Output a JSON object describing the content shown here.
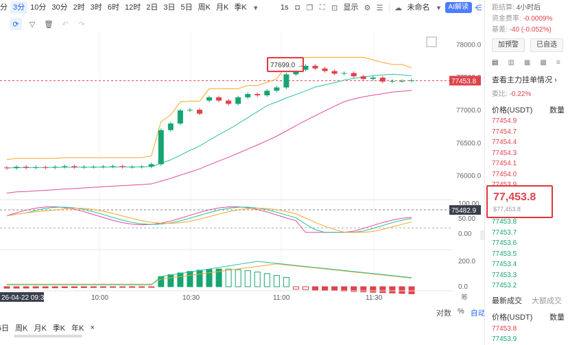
{
  "toolbar": {
    "timeframes": [
      "分",
      "3分",
      "10分",
      "30分",
      "2时",
      "3时",
      "6时",
      "12时",
      "2日",
      "3日",
      "5日",
      "周K",
      "月K",
      "季K"
    ],
    "active_timeframe": "3分",
    "speed": "1s",
    "display": "显示",
    "layout_name": "未命名",
    "ai_button": "AI解读"
  },
  "price_axis": {
    "labels": [
      "78000.0",
      "77500.0",
      "77000.0",
      "76500.0",
      "76000.0"
    ],
    "last_price": "77453.8",
    "low_marker": "75482.9",
    "annotation": "77699.0"
  },
  "indicator_axis": {
    "labels": [
      "100.00",
      "50.00",
      "0.00"
    ]
  },
  "volume_axis": {
    "labels": [
      "200.0",
      "0.0"
    ]
  },
  "time_axis": {
    "labels": [
      "10:00",
      "10:30",
      "11:00",
      "11:30"
    ],
    "cursor_time": "26-04-22 09:33"
  },
  "bottom_bar": {
    "periods": [
      "5日",
      "周K",
      "月K",
      "季K",
      "年K"
    ],
    "close": "×",
    "right": [
      "对数",
      "%",
      "自动"
    ]
  },
  "axis_side_label": "筹",
  "right_panel": {
    "settlement_label": "距结算:",
    "settlement_value": "4小时后",
    "funding_label": "资金费率:",
    "funding_value": "-0.0009%",
    "basis_label": "基差:",
    "basis_value": "-40 (-0.052%)",
    "alert_button": "加预警",
    "watchlist_button": "已自选",
    "depth_link": "查看主力挂单情况",
    "ratio_label": "委比:",
    "ratio_value": "-0.22%",
    "header_price": "价格(USDT)",
    "header_qty": "数量",
    "asks": [
      "77454.9",
      "77454.7",
      "77454.4",
      "77454.3",
      "77454.1",
      "77454.0",
      "77453.9"
    ],
    "last_price": "77,453.8",
    "last_price_usd": "$77,453.8",
    "bids": [
      "77453.8",
      "77453.7",
      "77453.6",
      "77453.5",
      "77453.4",
      "77453.3",
      "77453.2"
    ],
    "tab_latest": "最新成交",
    "tab_large": "大额成交",
    "trade_header_price": "价格(USDT)",
    "trade_header_qty": "数量",
    "trades": [
      "77453.8",
      "77453.9"
    ]
  },
  "colors": {
    "up": "#16a572",
    "down": "#e0424b",
    "accent": "#1e63f0",
    "ma_orange": "#f5a623",
    "ma_teal": "#2bbfa4",
    "ma_pink": "#e0489a"
  },
  "chart_data": {
    "type": "candlestick",
    "x": [
      "09:33",
      "09:36",
      "09:39",
      "09:42",
      "09:45",
      "09:48",
      "09:51",
      "09:54",
      "09:57",
      "10:00",
      "10:03",
      "10:06",
      "10:09",
      "10:12",
      "10:15",
      "10:18",
      "10:21",
      "10:24",
      "10:27",
      "10:30",
      "10:33",
      "10:36",
      "10:39",
      "10:42",
      "10:45",
      "10:48",
      "10:51",
      "10:54",
      "10:57",
      "11:00",
      "11:03",
      "11:06",
      "11:09",
      "11:12",
      "11:15",
      "11:18",
      "11:21",
      "11:24",
      "11:27",
      "11:30",
      "11:33",
      "11:36",
      "11:39"
    ],
    "open": [
      76130,
      76120,
      76140,
      76125,
      76135,
      76128,
      76140,
      76150,
      76135,
      76140,
      76142,
      76145,
      76150,
      76138,
      76140,
      76145,
      76180,
      76700,
      76800,
      77000,
      77010,
      77150,
      77200,
      77150,
      77100,
      77200,
      77250,
      77230,
      77300,
      77350,
      77550,
      77620,
      77680,
      77640,
      77600,
      77560,
      77570,
      77520,
      77480,
      77500,
      77440,
      77450,
      77450
    ],
    "close": [
      76120,
      76140,
      76125,
      76135,
      76128,
      76140,
      76150,
      76135,
      76140,
      76142,
      76145,
      76150,
      76138,
      76140,
      76145,
      76180,
      76700,
      76800,
      77000,
      77010,
      76950,
      77200,
      77150,
      77100,
      77200,
      77250,
      77230,
      77300,
      77350,
      77550,
      77620,
      77680,
      77640,
      77600,
      77560,
      77570,
      77520,
      77480,
      77500,
      77440,
      77450,
      77450,
      77460
    ],
    "price_min": 75850,
    "price_max": 78150,
    "rsi_series_ylim": [
      0,
      100
    ],
    "volume_ylim": [
      0,
      260
    ]
  }
}
